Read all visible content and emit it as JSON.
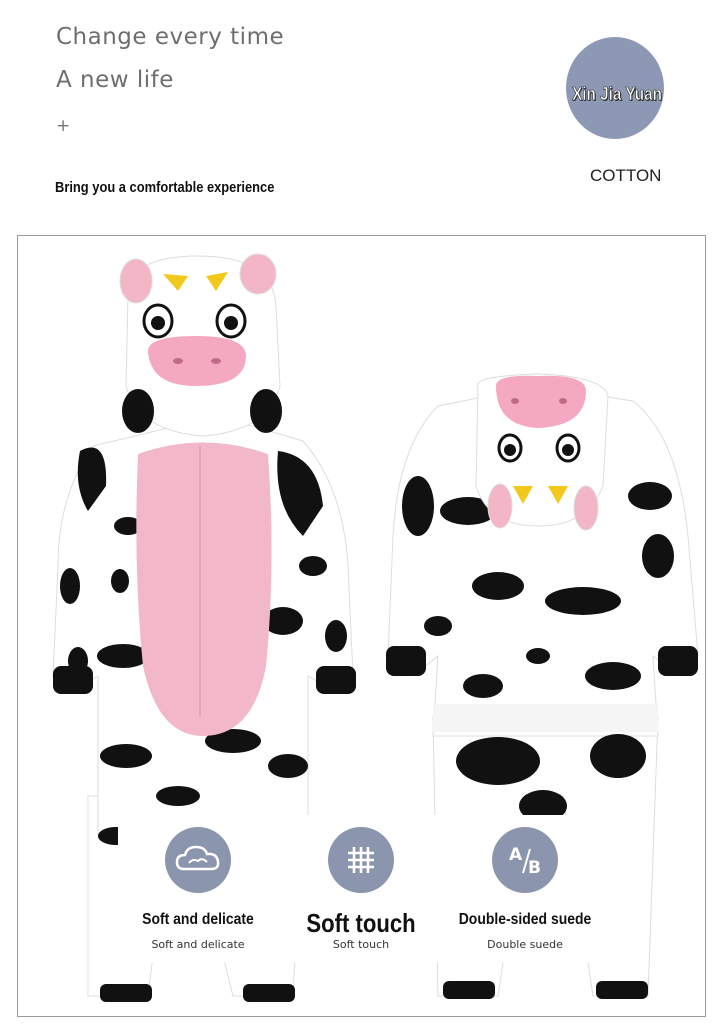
{
  "tagline": {
    "line1": "Change every time",
    "line2": "A new life",
    "plus": "+",
    "subtitle": "Bring you a comfortable experience"
  },
  "brand": {
    "name": "Xin Jia Yuan",
    "circle_color": "#8c98b4"
  },
  "material": "COTTON",
  "product_photo": {
    "subject": "cow-pattern-onesie-front-and-back",
    "colors": {
      "body": "#ffffff",
      "spots": "#111111",
      "belly": "#f2b7c8",
      "nose": "#f5a9c0",
      "horns": "#f2c81a"
    }
  },
  "features": [
    {
      "icon": "cloud-icon",
      "title": "Soft and delicate",
      "caption": "Soft and delicate"
    },
    {
      "icon": "grid-texture-icon",
      "title": "Soft touch",
      "caption": "Soft touch"
    },
    {
      "icon": "ab-icon",
      "title": "Double-sided suede",
      "caption": "Double suede"
    }
  ]
}
